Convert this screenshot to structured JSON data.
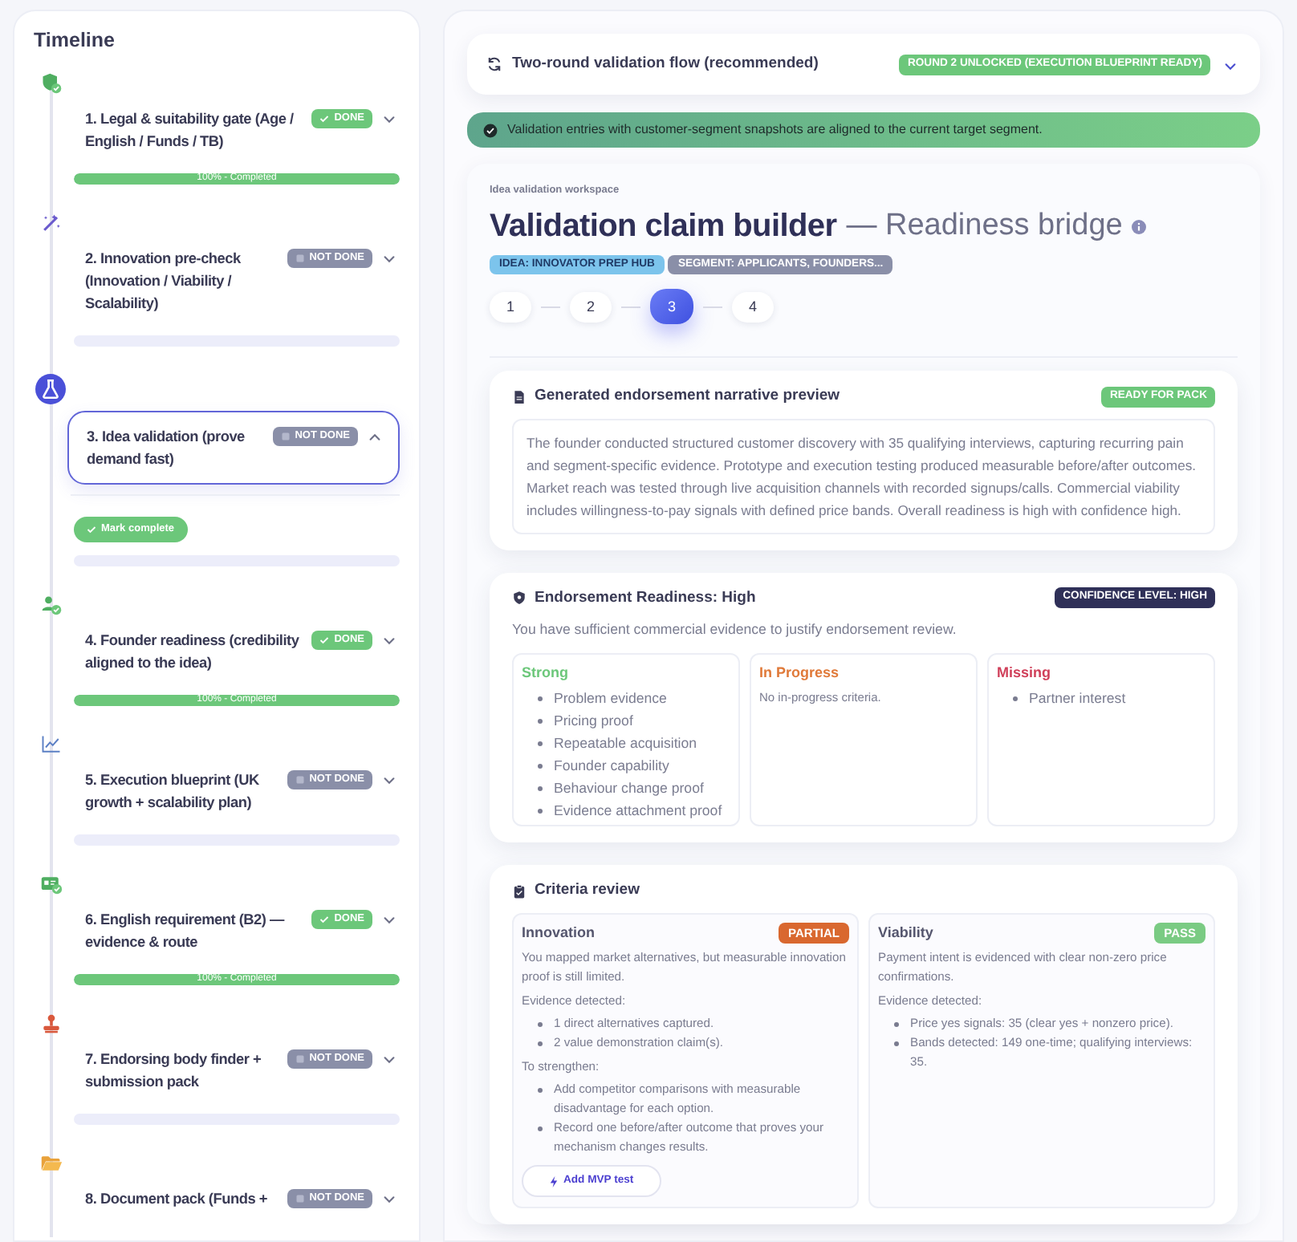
{
  "timeline": {
    "title": "Timeline",
    "steps": [
      {
        "title": "1. Legal & suitability gate (Age / English / Funds / TB)",
        "done": true,
        "status": "DONE",
        "expanded": false,
        "selected": false,
        "progress": {
          "level": 1,
          "label": "100% - Completed"
        }
      },
      {
        "title": "2. Innovation pre-check (Innovation / Viability / Scalability)",
        "done": false,
        "status": "NOT DONE",
        "expanded": false,
        "selected": false,
        "progress": {
          "level": 0
        }
      },
      {
        "title": "3. Idea validation (prove demand fast)",
        "done": false,
        "status": "NOT DONE",
        "expanded": true,
        "selected": true,
        "action": "Mark complete",
        "progress": {
          "level": 0
        }
      },
      {
        "title": "4. Founder readiness (credibility aligned to the idea)",
        "done": true,
        "status": "DONE",
        "expanded": false,
        "selected": false,
        "progress": {
          "level": 1,
          "label": "100% - Completed"
        }
      },
      {
        "title": "5. Execution blueprint (UK growth + scalability plan)",
        "done": false,
        "status": "NOT DONE",
        "expanded": false,
        "selected": false,
        "progress": {
          "level": 0
        }
      },
      {
        "title": "6. English requirement (B2) — evidence & route",
        "done": true,
        "status": "DONE",
        "expanded": false,
        "selected": false,
        "progress": {
          "level": 1,
          "label": "100% - Completed"
        }
      },
      {
        "title": "7. Endorsing body finder + submission pack",
        "done": false,
        "status": "NOT DONE",
        "expanded": false,
        "selected": false,
        "progress": {
          "level": 0
        }
      },
      {
        "title": "8. Document pack (Funds +",
        "done": false,
        "status": "NOT DONE",
        "expanded": false,
        "selected": false
      }
    ]
  },
  "flow": {
    "title": "Two-round validation flow (recommended)",
    "status": "ROUND 2 UNLOCKED (EXECUTION BLUEPRINT READY)",
    "expanded": false
  },
  "alert": {
    "text": "Validation entries with customer-segment snapshots are aligned to the current target segment."
  },
  "workspace": {
    "eyebrow": "Idea validation workspace",
    "title": "Validation claim builder",
    "subtitle": "— Readiness bridge",
    "tags": [
      {
        "label": "IDEA: INNOVATOR PREP HUB",
        "color": "#7cc4ec"
      },
      {
        "label": "SEGMENT: APPLICANTS, FOUNDERS...",
        "color": "#8a8fa8"
      }
    ],
    "steps": [
      {
        "label": "1",
        "selected": false
      },
      {
        "label": "2",
        "selected": false
      },
      {
        "label": "3",
        "selected": true
      },
      {
        "label": "4",
        "selected": false
      }
    ]
  },
  "narrative": {
    "title": "Generated endorsement narrative preview",
    "status": "READY FOR PACK",
    "text": "The founder conducted structured customer discovery with 35 qualifying interviews, capturing recurring pain and segment-specific evidence. Prototype and execution testing produced measurable before/after outcomes. Market reach was tested through live acquisition channels with recorded signups/calls. Commercial viability includes willingness-to-pay signals with defined price bands. Overall readiness is high with confidence high."
  },
  "readiness": {
    "title": "Endorsement Readiness: High",
    "confidence": "CONFIDENCE LEVEL: HIGH",
    "summary": "You have sufficient commercial evidence to justify endorsement review.",
    "columns": [
      {
        "heading": "Strong",
        "color": "#6cc77a",
        "items": [
          "Problem evidence",
          "Pricing proof",
          "Repeatable acquisition",
          "Founder capability",
          "Behaviour change proof",
          "Evidence attachment proof"
        ]
      },
      {
        "heading": "In Progress",
        "color": "#e07a3a",
        "note": "No in-progress criteria."
      },
      {
        "heading": "Missing",
        "color": "#d0405a",
        "items": [
          "Partner interest"
        ]
      }
    ]
  },
  "criteria": {
    "title": "Criteria review",
    "cards": [
      {
        "name": "Innovation",
        "verdict": "PARTIAL",
        "color": "#d9682f",
        "summary": "You mapped market alternatives, but measurable innovation proof is still limited.",
        "evidence_label": "Evidence detected:",
        "evidence": [
          "1 direct alternatives captured.",
          "2 value demonstration claim(s)."
        ],
        "strengthen_label": "To strengthen:",
        "strengthen": [
          "Add competitor comparisons with measurable disadvantage for each option.",
          "Record one before/after outcome that proves your mechanism changes results."
        ],
        "action": "Add MVP test"
      },
      {
        "name": "Viability",
        "verdict": "PASS",
        "color": "#7acb83",
        "summary": "Payment intent is evidenced with clear non-zero price confirmations.",
        "evidence_label": "Evidence detected:",
        "evidence": [
          "Price yes signals: 35 (clear yes + nonzero price).",
          "Bands detected: 149 one-time; qualifying interviews: 35."
        ]
      }
    ]
  }
}
